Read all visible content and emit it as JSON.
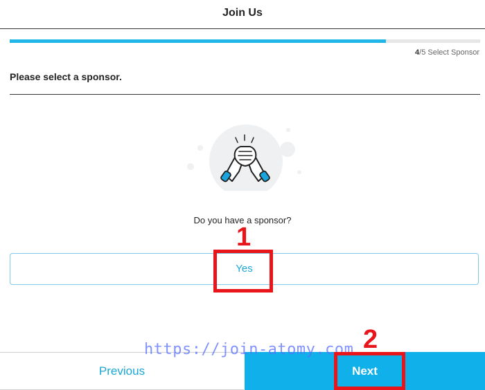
{
  "header": {
    "title": "Join Us"
  },
  "progress": {
    "current_step": "4",
    "step_total": "/5",
    "step_name": "Select Sponsor",
    "fill_fraction": 0.8
  },
  "prompt": {
    "text": "Please select a sponsor."
  },
  "illustration": {
    "icon": "handshake-icon"
  },
  "question": {
    "text": "Do you have a sponsor?"
  },
  "options": {
    "yes_label": "Yes"
  },
  "annotations": {
    "step1": "1",
    "step2": "2",
    "watermark": "https://join-atomy.com"
  },
  "footer": {
    "previous_label": "Previous",
    "next_label": "Next"
  },
  "colors": {
    "accent": "#10b1ea",
    "highlight": "#e8151b",
    "watermark": "#586eff"
  }
}
